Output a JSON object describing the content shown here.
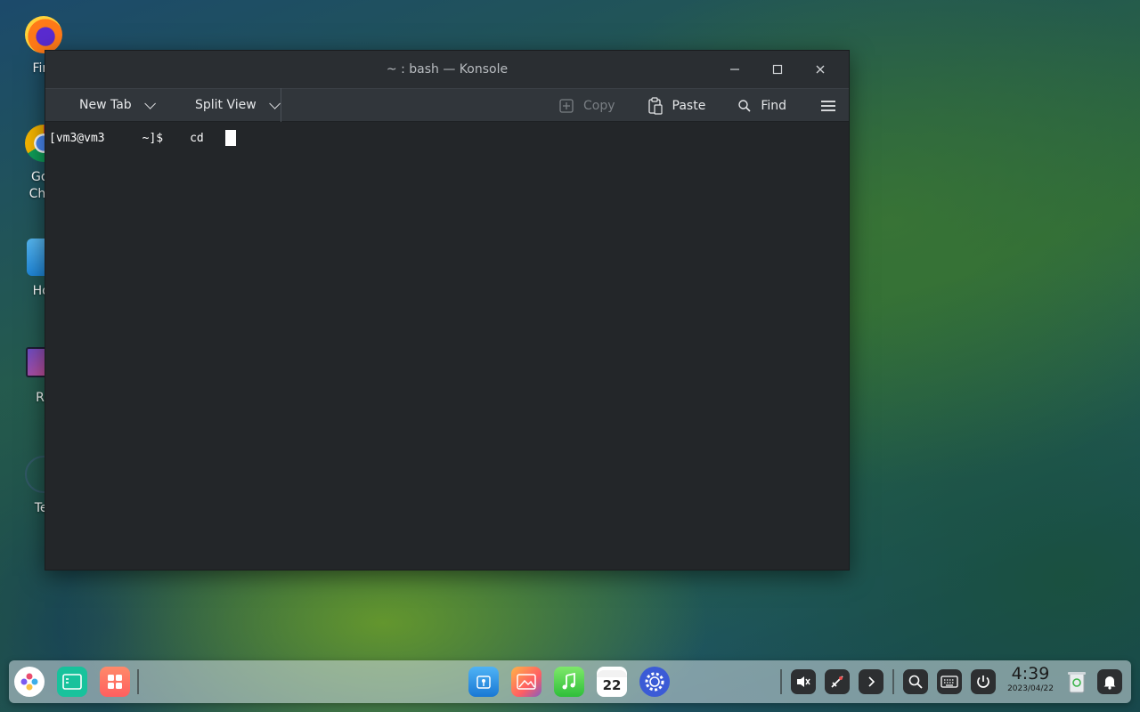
{
  "desktop": {
    "icons": [
      {
        "label": "Fire"
      },
      {
        "label": "Goo\nChro"
      },
      {
        "label": "Hor"
      },
      {
        "label": "Ro"
      },
      {
        "label": "Ter"
      }
    ]
  },
  "window": {
    "title": "~ : bash — Konsole",
    "controls": {
      "minimize": "–",
      "maximize": "□",
      "close": "✕"
    }
  },
  "toolbar": {
    "new_tab": "New Tab",
    "split_view": "Split View",
    "copy": "Copy",
    "paste": "Paste",
    "find": "Find"
  },
  "terminal": {
    "user_host": "[vm3@vm3",
    "path_prompt": "~]$",
    "command": "cd"
  },
  "dock": {
    "calendar_day": "22",
    "clock_time": "4:39",
    "clock_date": "2023/04/22"
  },
  "colors": {
    "accent": "#3daee9",
    "window_bg": "#232629",
    "toolbar_bg": "#31363b"
  }
}
